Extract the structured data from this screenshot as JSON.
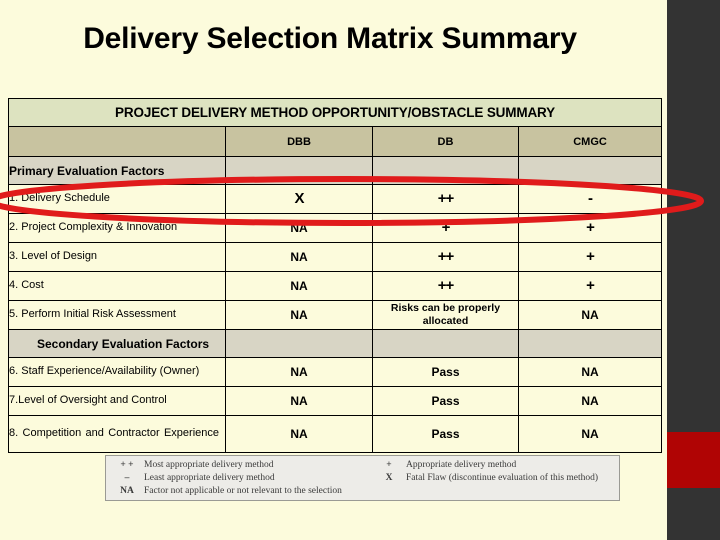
{
  "slide": {
    "title": "Delivery Selection Matrix Summary",
    "banner": "PROJECT DELIVERY METHOD OPPORTUNITY/OBSTACLE SUMMARY"
  },
  "colors": {
    "page_background": "#fcfbdc",
    "banner_green": "#dde3c0",
    "header_tan": "#c8c3a0",
    "section_gray": "#d8d5c5",
    "rail_dark": "#333333",
    "rail_accent_red": "#b00404",
    "highlight_red": "#e01b1b"
  },
  "table": {
    "columns": [
      "",
      "DBB",
      "DB",
      "CMGC"
    ],
    "sections": [
      {
        "label": "Primary Evaluation Factors",
        "rows": [
          {
            "factor": "1. Delivery Schedule",
            "values": [
              "X",
              "++",
              "-"
            ]
          },
          {
            "factor": "2. Project Complexity & Innovation",
            "values": [
              "NA",
              "+",
              "+"
            ]
          },
          {
            "factor": "3. Level of Design",
            "values": [
              "NA",
              "++",
              "+"
            ]
          },
          {
            "factor": "4. Cost",
            "values": [
              "NA",
              "++",
              "+"
            ]
          },
          {
            "factor": "5. Perform Initial Risk Assessment",
            "values": [
              "NA",
              "Risks can be properly allocated",
              "NA"
            ]
          }
        ]
      },
      {
        "label": "Secondary Evaluation Factors",
        "rows": [
          {
            "factor": "6. Staff Experience/Availability (Owner)",
            "values": [
              "NA",
              "Pass",
              "NA"
            ]
          },
          {
            "factor": "7.Level of Oversight and Control",
            "values": [
              "NA",
              "Pass",
              "NA"
            ]
          },
          {
            "factor": "8.  Competition  and  Contractor Experience",
            "values": [
              "NA",
              "Pass",
              "NA"
            ]
          }
        ]
      }
    ]
  },
  "legend": {
    "left": [
      {
        "symbol": "+ +",
        "text": "Most appropriate delivery method"
      },
      {
        "symbol": "–",
        "text": "Least appropriate delivery method"
      }
    ],
    "right": [
      {
        "symbol": "+",
        "text": "Appropriate delivery method"
      },
      {
        "symbol": "X",
        "text": "Fatal Flaw (discontinue evaluation of this method)"
      }
    ],
    "na": {
      "symbol": "NA",
      "text": "Factor not applicable or not relevant to the selection"
    }
  },
  "annotation": {
    "highlight_row_label": "1. Delivery Schedule",
    "shape": "ellipse"
  }
}
